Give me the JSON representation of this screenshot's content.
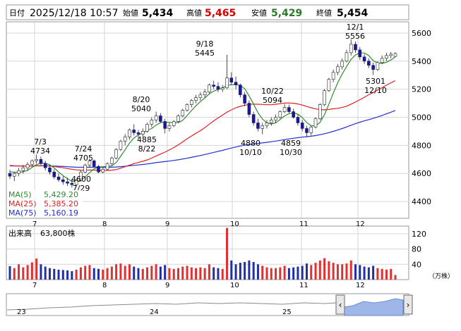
{
  "header": {
    "date_label": "日付",
    "date_value": "2025/12/18 10:57",
    "open_label": "始値",
    "open_value": "5,434",
    "high_label": "高値",
    "high_value": "5,465",
    "low_label": "安値",
    "low_value": "5,429",
    "close_label": "終値",
    "close_value": "5,454"
  },
  "colors": {
    "up": "#d40000",
    "down": "#1a1a8c",
    "ma5": "#2e8b2e",
    "ma25": "#e02020",
    "ma75": "#2030d0",
    "high_value": "#d40000",
    "low_value": "#2a7a2a",
    "volume_up": "#e03030",
    "volume_down": "#2030a0",
    "navigator_fill": "#9fb6e8"
  },
  "legend": [
    {
      "label": "MA(5)",
      "value": "5,429.20",
      "color": "#2e8b2e"
    },
    {
      "label": "MA(25)",
      "value": "5,385.20",
      "color": "#e02020"
    },
    {
      "label": "MA(75)",
      "value": "5,160.19",
      "color": "#2030d0"
    }
  ],
  "volume": {
    "label": "出来高",
    "value": "63,800株",
    "unit": "（万株）",
    "ticks": [
      "120",
      "80",
      "40"
    ]
  },
  "navigator": {
    "labels": [
      "23",
      "24",
      "25"
    ],
    "left_handle_icon": "scroll-left-icon",
    "right_handle_icon": "scroll-right-icon"
  },
  "annotations": [
    {
      "date": "7/3",
      "value": "4734"
    },
    {
      "date": "7/24",
      "value": "4705"
    },
    {
      "date": "7/29",
      "value": "4600"
    },
    {
      "date": "8/20",
      "value": "5040"
    },
    {
      "date": "8/22",
      "value": "4885"
    },
    {
      "date": "9/18",
      "value": "5445"
    },
    {
      "date": "10/10",
      "value": "4880"
    },
    {
      "date": "10/22",
      "value": "5094"
    },
    {
      "date": "10/30",
      "value": "4859"
    },
    {
      "date": "12/1",
      "value": "5556"
    },
    {
      "date": "12/10",
      "value": "5301"
    }
  ],
  "chart_data": {
    "type": "candlestick",
    "y_ticks": [
      "5600",
      "5400",
      "5200",
      "5000",
      "4800",
      "4600",
      "4400"
    ],
    "ylim": [
      4280,
      5680
    ],
    "x_ticks": [
      "7",
      "8",
      "9",
      "10",
      "11",
      "12"
    ],
    "volume_ylim": [
      0,
      140
    ],
    "candles": [
      [
        4600,
        4625,
        4560,
        4580,
        35
      ],
      [
        4580,
        4610,
        4545,
        4600,
        30
      ],
      [
        4600,
        4640,
        4580,
        4620,
        40
      ],
      [
        4620,
        4660,
        4600,
        4640,
        32
      ],
      [
        4640,
        4680,
        4620,
        4665,
        38
      ],
      [
        4665,
        4700,
        4650,
        4690,
        45
      ],
      [
        4690,
        4734,
        4670,
        4700,
        55
      ],
      [
        4700,
        4720,
        4660,
        4670,
        40
      ],
      [
        4670,
        4690,
        4620,
        4640,
        34
      ],
      [
        4640,
        4660,
        4590,
        4610,
        30
      ],
      [
        4610,
        4630,
        4560,
        4575,
        28
      ],
      [
        4575,
        4600,
        4540,
        4555,
        26
      ],
      [
        4555,
        4580,
        4520,
        4540,
        25
      ],
      [
        4540,
        4570,
        4510,
        4530,
        24
      ],
      [
        4530,
        4560,
        4500,
        4520,
        22
      ],
      [
        4520,
        4560,
        4505,
        4550,
        26
      ],
      [
        4550,
        4620,
        4540,
        4610,
        32
      ],
      [
        4610,
        4670,
        4600,
        4660,
        36
      ],
      [
        4660,
        4705,
        4640,
        4690,
        38
      ],
      [
        4690,
        4700,
        4640,
        4650,
        30
      ],
      [
        4650,
        4660,
        4600,
        4610,
        28
      ],
      [
        4610,
        4640,
        4600,
        4630,
        26
      ],
      [
        4630,
        4680,
        4620,
        4670,
        30
      ],
      [
        4670,
        4720,
        4660,
        4710,
        34
      ],
      [
        4710,
        4780,
        4700,
        4770,
        40
      ],
      [
        4770,
        4840,
        4760,
        4830,
        42
      ],
      [
        4830,
        4880,
        4800,
        4860,
        36
      ],
      [
        4860,
        4920,
        4840,
        4910,
        40
      ],
      [
        4910,
        4950,
        4870,
        4890,
        34
      ],
      [
        4890,
        4910,
        4850,
        4880,
        30
      ],
      [
        4880,
        4920,
        4860,
        4900,
        28
      ],
      [
        4900,
        4960,
        4890,
        4950,
        32
      ],
      [
        4950,
        5000,
        4930,
        4980,
        36
      ],
      [
        4980,
        5040,
        4960,
        5010,
        40
      ],
      [
        5010,
        5030,
        4960,
        4970,
        34
      ],
      [
        4970,
        4990,
        4885,
        4920,
        38
      ],
      [
        4920,
        4960,
        4900,
        4940,
        30
      ],
      [
        4940,
        4980,
        4930,
        4970,
        28
      ],
      [
        4970,
        5020,
        4960,
        5010,
        30
      ],
      [
        5010,
        5060,
        5000,
        5050,
        34
      ],
      [
        5050,
        5100,
        5040,
        5090,
        36
      ],
      [
        5090,
        5130,
        5070,
        5120,
        32
      ],
      [
        5120,
        5160,
        5100,
        5140,
        30
      ],
      [
        5140,
        5180,
        5120,
        5160,
        32
      ],
      [
        5160,
        5200,
        5140,
        5180,
        30
      ],
      [
        5180,
        5240,
        5170,
        5230,
        40
      ],
      [
        5230,
        5260,
        5200,
        5220,
        32
      ],
      [
        5220,
        5250,
        5180,
        5200,
        30
      ],
      [
        5200,
        5230,
        5180,
        5210,
        28
      ],
      [
        5210,
        5445,
        5200,
        5280,
        90
      ],
      [
        5280,
        5320,
        5230,
        5250,
        50
      ],
      [
        5250,
        5290,
        5200,
        5230,
        40
      ],
      [
        5230,
        5240,
        5140,
        5160,
        44
      ],
      [
        5160,
        5180,
        5080,
        5100,
        46
      ],
      [
        5100,
        5120,
        5000,
        5020,
        50
      ],
      [
        5020,
        5040,
        4940,
        4960,
        46
      ],
      [
        4960,
        4990,
        4900,
        4920,
        40
      ],
      [
        4920,
        4960,
        4880,
        4940,
        36
      ],
      [
        4940,
        4980,
        4920,
        4960,
        32
      ],
      [
        4960,
        5000,
        4940,
        4980,
        30
      ],
      [
        4980,
        5020,
        4960,
        5000,
        30
      ],
      [
        5000,
        5050,
        4990,
        5040,
        32
      ],
      [
        5040,
        5094,
        5030,
        5070,
        36
      ],
      [
        5070,
        5090,
        5030,
        5040,
        30
      ],
      [
        5040,
        5060,
        4990,
        5000,
        32
      ],
      [
        5000,
        5020,
        4940,
        4960,
        34
      ],
      [
        4960,
        4980,
        4900,
        4920,
        36
      ],
      [
        4920,
        4940,
        4859,
        4890,
        42
      ],
      [
        4890,
        4940,
        4870,
        4930,
        38
      ],
      [
        4930,
        5000,
        4920,
        4990,
        44
      ],
      [
        4990,
        5100,
        4980,
        5090,
        50
      ],
      [
        5090,
        5200,
        5080,
        5190,
        56
      ],
      [
        5190,
        5280,
        5180,
        5270,
        48
      ],
      [
        5270,
        5340,
        5250,
        5320,
        44
      ],
      [
        5320,
        5380,
        5300,
        5360,
        40
      ],
      [
        5360,
        5420,
        5340,
        5400,
        40
      ],
      [
        5400,
        5480,
        5390,
        5460,
        42
      ],
      [
        5460,
        5556,
        5440,
        5520,
        50
      ],
      [
        5520,
        5540,
        5460,
        5480,
        40
      ],
      [
        5480,
        5500,
        5410,
        5430,
        38
      ],
      [
        5430,
        5450,
        5380,
        5400,
        34
      ],
      [
        5400,
        5420,
        5350,
        5370,
        32
      ],
      [
        5370,
        5390,
        5301,
        5340,
        36
      ],
      [
        5340,
        5400,
        5330,
        5390,
        30
      ],
      [
        5390,
        5440,
        5380,
        5420,
        28
      ],
      [
        5420,
        5460,
        5400,
        5440,
        26
      ],
      [
        5440,
        5465,
        5420,
        5450,
        28
      ],
      [
        5434,
        5465,
        5429,
        5454,
        12
      ]
    ],
    "ma5_start": 4620,
    "ma25_start": 4660,
    "ma75_start": 4655
  }
}
